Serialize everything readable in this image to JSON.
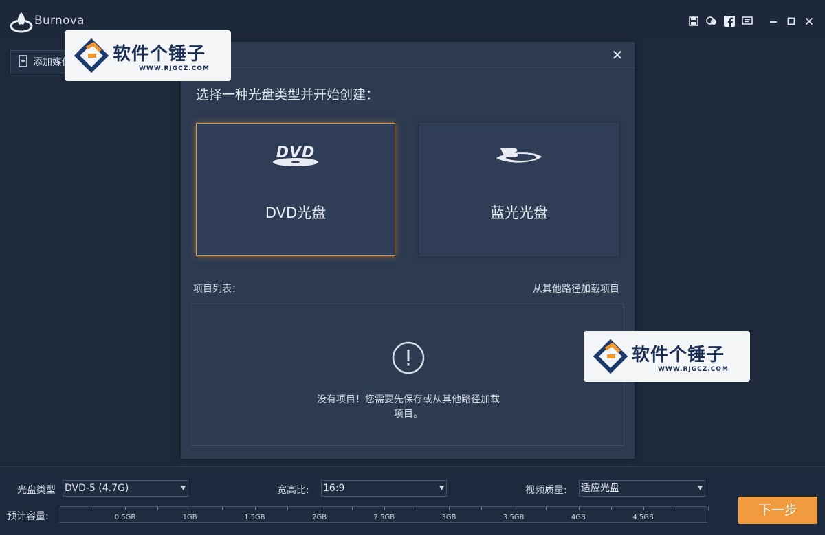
{
  "app": {
    "title": "Burnova"
  },
  "toolbar": {
    "add_media_label": "添加媒体"
  },
  "dialog": {
    "close_glyph": "✕",
    "prompt": "选择一种光盘类型并开始创建：",
    "cards": [
      {
        "logo": "DVD",
        "label": "DVD光盘",
        "selected": true
      },
      {
        "logo": "blu-ray",
        "label": "蓝光光盘",
        "selected": false
      }
    ],
    "project_list_label": "项目列表：",
    "load_link": "从其他路径加载项目",
    "empty_line1": "没有项目！您需要先保存或从其他路径加载",
    "empty_line2": "项目。"
  },
  "watermark": {
    "text": "软件个锤子",
    "url": "WWW.RJGCZ.COM"
  },
  "bottom": {
    "disc_type_label": "光盘类型",
    "disc_type_value": "DVD-5 (4.7G)",
    "aspect_label": "宽高比:",
    "aspect_value": "16:9",
    "quality_label": "视频质量:",
    "quality_value": "适应光盘",
    "capacity_label": "预计容量:",
    "capacity_ticks": [
      "0.5GB",
      "1GB",
      "1.5GB",
      "2GB",
      "2.5GB",
      "3GB",
      "3.5GB",
      "4GB",
      "4.5GB"
    ],
    "next_label": "下一步"
  },
  "colors": {
    "accent": "#f29a3e",
    "selected_border": "#e39a3b",
    "background": "#1e2a3c",
    "dialog": "#2d3b51"
  }
}
